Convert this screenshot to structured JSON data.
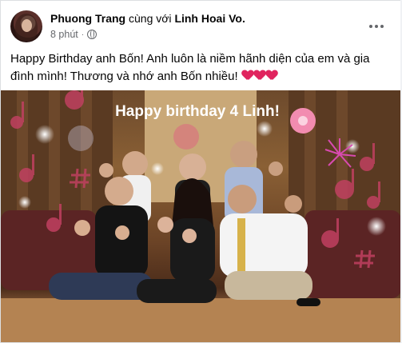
{
  "post": {
    "author": "Phuong Trang",
    "with_text": "cùng với",
    "tagged": "Linh Hoai Vo.",
    "time": "8 phút",
    "separator": "·",
    "privacy_icon": "globe-icon",
    "menu_icon": "more-options-icon",
    "text": "Happy Birthday anh Bốn! Anh luôn là niềm hãnh diện của em và gia đình mình! Thương và nhớ anh Bốn nhiều!",
    "hearts": 3,
    "heart_color": "#e0245e"
  },
  "photo": {
    "overlay_title": "Happy birthday 4 Linh!",
    "decorations": [
      "music-note-icon",
      "sparkle-icon",
      "flower-icon",
      "hashtag-icon",
      "firework-icon"
    ],
    "decoration_color": "#c04060"
  }
}
